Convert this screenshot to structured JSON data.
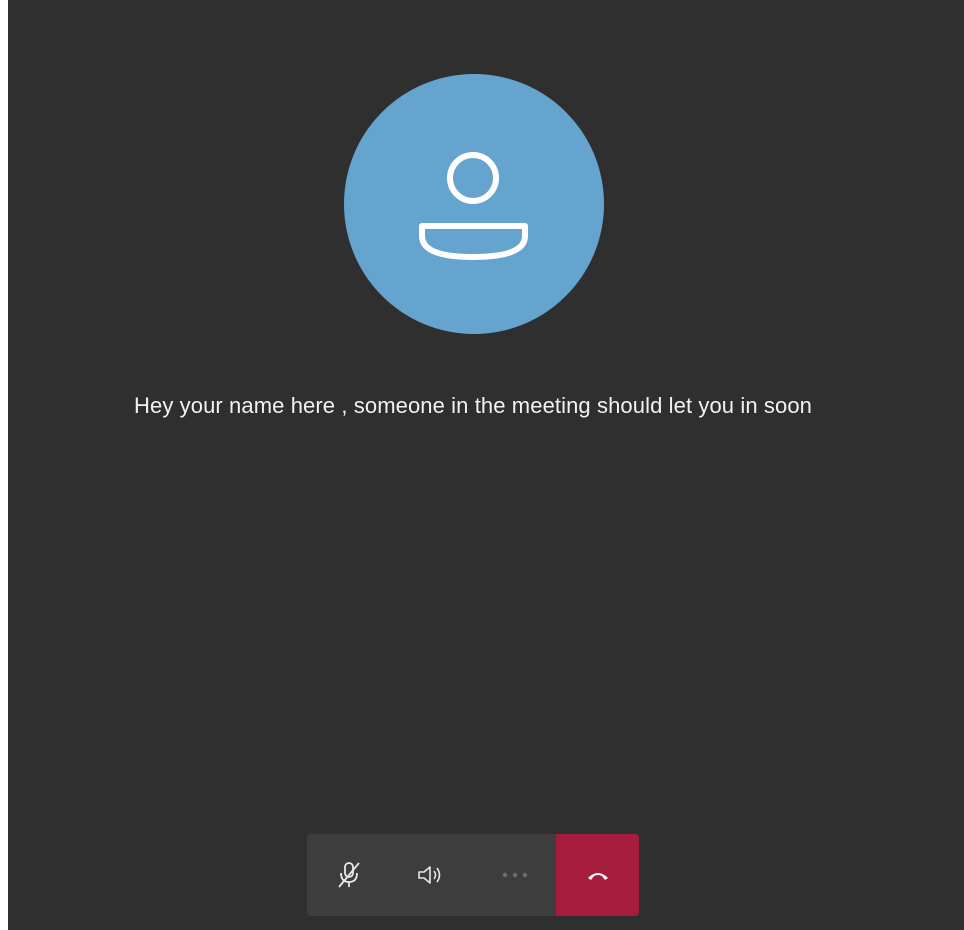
{
  "lobby": {
    "message": "Hey your name here , someone in the meeting should let you in soon",
    "avatar_icon": "person-icon",
    "avatar_color": "#65a4cf",
    "background_color": "#2f2f2f"
  },
  "toolbar": {
    "buttons": [
      {
        "icon": "mic-off-icon"
      },
      {
        "icon": "speaker-icon"
      },
      {
        "icon": "more-options-icon",
        "enabled": false
      },
      {
        "icon": "hang-up-icon",
        "color": "#a51c3c"
      }
    ]
  }
}
